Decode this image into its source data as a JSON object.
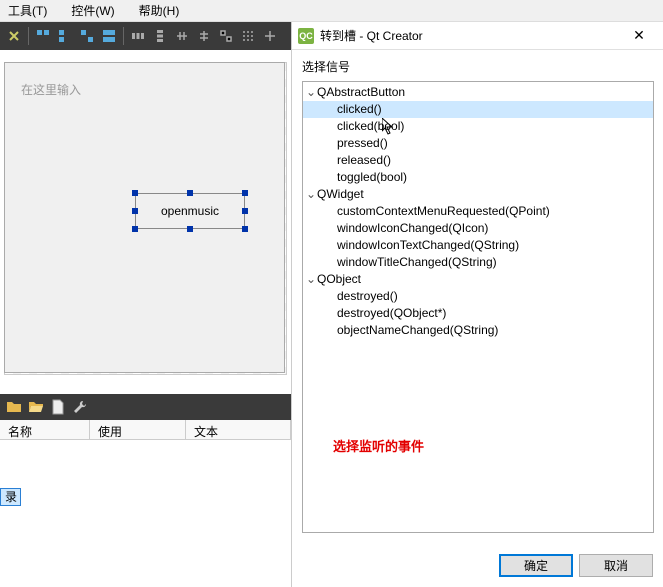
{
  "menubar": {
    "tools": "工具(T)",
    "widgets": "控件(W)",
    "help": "帮助(H)"
  },
  "form": {
    "type_here": "在这里输入",
    "widget_text": "openmusic"
  },
  "props": {
    "col_name": "名称",
    "col_used": "使用",
    "col_text": "文本",
    "row0": "录"
  },
  "dialog": {
    "icon": "QC",
    "title": "转到槽 - Qt Creator",
    "section_label": "选择信号",
    "note": "选择监听的事件",
    "ok": "确定",
    "cancel": "取消"
  },
  "tree": {
    "groups": [
      {
        "name": "QAbstractButton",
        "signals": [
          "clicked()",
          "clicked(bool)",
          "pressed()",
          "released()",
          "toggled(bool)"
        ]
      },
      {
        "name": "QWidget",
        "signals": [
          "customContextMenuRequested(QPoint)",
          "windowIconChanged(QIcon)",
          "windowIconTextChanged(QString)",
          "windowTitleChanged(QString)"
        ]
      },
      {
        "name": "QObject",
        "signals": [
          "destroyed()",
          "destroyed(QObject*)",
          "objectNameChanged(QString)"
        ]
      }
    ],
    "selected": "clicked()"
  }
}
